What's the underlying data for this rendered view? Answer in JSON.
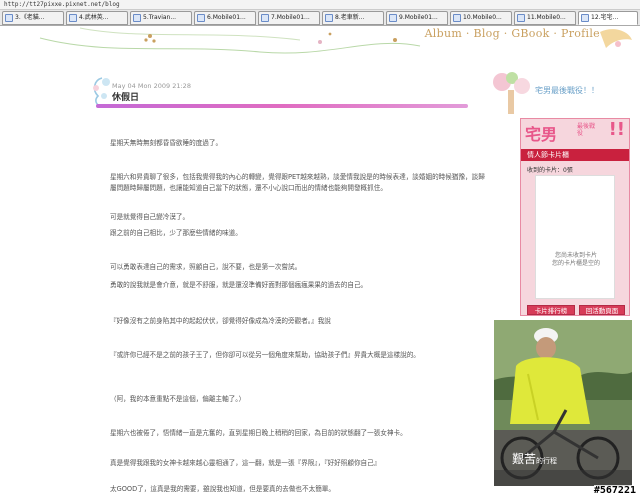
{
  "browser": {
    "address": "http://tt27pixxe.pixnet.net/blog",
    "tabs": [
      {
        "label": "3.《老貓..."
      },
      {
        "label": "4.武林英..."
      },
      {
        "label": "5.Travian..."
      },
      {
        "label": "6.Mobile01..."
      },
      {
        "label": "7.Mobile01..."
      },
      {
        "label": "8.老車新..."
      },
      {
        "label": "9.Mobile01..."
      },
      {
        "label": "10.Mobile0..."
      },
      {
        "label": "11.Mobile0..."
      },
      {
        "label": "12.宅宅..."
      }
    ]
  },
  "nav": {
    "label": "Album · Blog · GBook · Profile"
  },
  "post": {
    "date": "May 04 Mon 2009 21:28",
    "title": "休假日",
    "paragraphs": [
      "星期天無時無刻都昏昏欲睡的度過了。",
      "星期六和昇貴聊了很多，包括我覺得我的內心的轉變，覺得跟PET越來越熟，談愛情我說是的時候表達，談婚姻的時候猶豫，談歸屬問題時歸屬問題，也讓能知道自己當下的狀態，還不小心說口而出的情緒也能夠開發概抓住。",
      "可是就覺得自己變冷漠了。",
      "跟之前的自己相比，少了那麼些情緒的味道。",
      "可以勇敢表達自己的需求，照顧自己，說不要，也是第一次嘗試。",
      "勇敢的說我就是會介意，就是不舒服，就是還沒準備好面對那個瘋瘋果果的過去的自己。",
      "『好像沒有之前身陷其中的起起伏伏，卻覺得好像成為冷漠的旁觀者。』我說",
      "『或許你已經不是之前的孩子王了，但你卻可以從另一個角度來幫助，協助孩子們』昇貴大概是這樣說的。",
      "（阿，我的本意重點不是這個，偏離主軸了。）",
      "星期六也被倦了，悟情緒一直是亢奮的，直到星期日晚上稍稍的回家，為目前的狀態翻了一張女神卡。",
      "真是覺得我跟我的女神卡越來越心靈相通了，這一翻，就是一張『界限』，『好好照顧你自己』",
      "太GOOD了，這真是我的需要，雖說我也知道，但是要真的去做也不太簡單。"
    ]
  },
  "sidebar": {
    "title": "宅男最後戰役！！",
    "card_widget": {
      "logo": "宅男",
      "logo_small": "最後戰役",
      "bang": "!!",
      "band_label": "情人節卡片櫃",
      "count_label": "收到的卡片：0張",
      "empty_line1": "您尚未收到卡片",
      "empty_line2": "您的卡片櫃是空的",
      "rank_button": "卡片排行榜",
      "back_button": "回活動頁面"
    },
    "photo_caption_big": "艱苦",
    "photo_caption_small": "的行程"
  },
  "watermark": "#567221",
  "colors": {
    "accent_pink": "#e06cc1",
    "nav_gold": "#c9a060",
    "card_red": "#c9213e",
    "sidebar_blue": "#6aa0c8"
  }
}
